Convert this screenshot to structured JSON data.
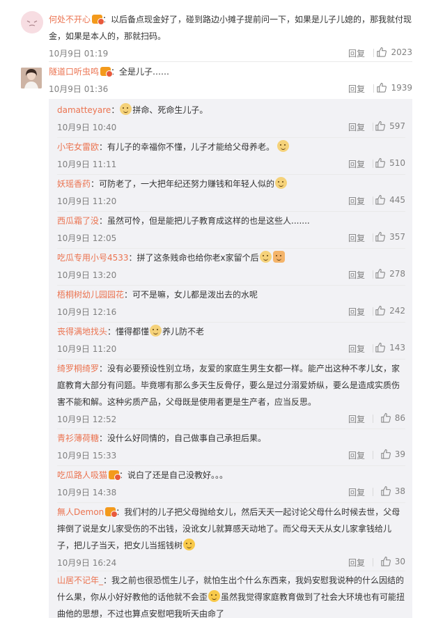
{
  "comments": [
    {
      "user": "何处不开心",
      "vip": true,
      "text": "：以后备点现金好了，碰到路边小摊子提前问一下，如果是儿子儿媳的，那我就付现金，如果是本人的，那就扫码。",
      "time": "10月9日 01:19",
      "reply": "回复",
      "likes": "2023",
      "avatar": "pink-avatar"
    },
    {
      "user": "隧道口听虫鸣",
      "vip": true,
      "text": "：全是儿子……",
      "time": "10月9日 01:36",
      "reply": "回复",
      "likes": "1939",
      "avatar": "photo-avatar"
    }
  ],
  "replies": [
    {
      "user": "damatteyare",
      "text_before": "：",
      "text_after": "拼命、死命生儿子。",
      "time": "10月9日 10:40",
      "reply": "回复",
      "likes": "597"
    },
    {
      "user": "小宅女雷欧",
      "text_before": "：有儿子的幸福你不懂，儿子才能给父母养老。",
      "text_after": "",
      "time": "10月9日 11:11",
      "reply": "回复",
      "likes": "510"
    },
    {
      "user": "妖瑶香药",
      "text_before": "：可防老了，一大把年纪还努力赚钱和年轻人似的",
      "text_after": "",
      "time": "10月9日 11:20",
      "reply": "回复",
      "likes": "445"
    },
    {
      "user": "西瓜霜了没",
      "text_before": "：虽然可怜，但是能把儿子教育成这样的也是这些人.......",
      "text_after": "",
      "time": "10月9日 12:05",
      "reply": "回复",
      "likes": "357"
    },
    {
      "user": "吃瓜专用小号4533",
      "text_before": "：拼了这条贱命也给你老x家留个后",
      "text_after": "",
      "time": "10月9日 13:20",
      "reply": "回复",
      "likes": "278"
    },
    {
      "user": "梧桐树幼儿园园花",
      "text_before": "：可不是嘛，女儿都是泼出去的水呢",
      "text_after": "",
      "time": "10月9日 12:16",
      "reply": "回复",
      "likes": "242"
    },
    {
      "user": "丧得满地找头",
      "text_before": "：懂得都懂",
      "text_after": "养儿防不老",
      "time": "10月9日 11:20",
      "reply": "回复",
      "likes": "143"
    },
    {
      "user": "绮罗桐绮罗",
      "text_before": "：没有必要预设性别立场，友爱的家庭生男生女都一样。能产出这种不孝儿女，家庭教育大部分有问题。毕竟哪有那么多天生反骨仔，要么是过分溺爱娇纵，要么是造成实质伤害不能和解。这种劣质产品，父母既是使用者更是生产者，应当反思。",
      "text_after": "",
      "time": "10月9日 12:52",
      "reply": "回复",
      "likes": "86"
    },
    {
      "user": "青衫薄荷糖",
      "text_before": "：没什么好同情的，自己做事自己承担后果。",
      "text_after": "",
      "time": "10月9日 15:33",
      "reply": "回复",
      "likes": "39"
    },
    {
      "user": "吃瓜路人吸猫",
      "vip": true,
      "text_before": "：说白了还是自己没教好。。。",
      "text_after": "",
      "time": "10月9日 14:38",
      "reply": "回复",
      "likes": "38"
    },
    {
      "user": "無人Demon",
      "vip": true,
      "text_before": "：我们村的儿子把父母抛给女儿，然后天天一起讨论父母什么时候去世，父母摔倒了说是女儿家受伤的不出钱，没讹女儿就算感天动地了。而父母天天从女儿家拿钱给儿子，把儿子当天，把女儿当摇钱树",
      "text_after": "",
      "time": "10月9日 16:24",
      "reply": "回复",
      "likes": "30"
    },
    {
      "user": "山居不记年_",
      "text_before": "：我之前也很恐慌生儿子，就怕生出个什么东西来，我妈安慰我说种的什么因结的什么果，你从小好好教他的话他就不会歪",
      "text_after": "虽然我觉得家庭教育做到了社会大环境也有可能扭曲他的思想，不过也算点安慰吧我听天由命了",
      "time": "",
      "reply": "",
      "likes": ""
    }
  ],
  "colors": {
    "username": "#eb7350",
    "meta": "#808080",
    "reply_bg": "#f2f2f5"
  }
}
